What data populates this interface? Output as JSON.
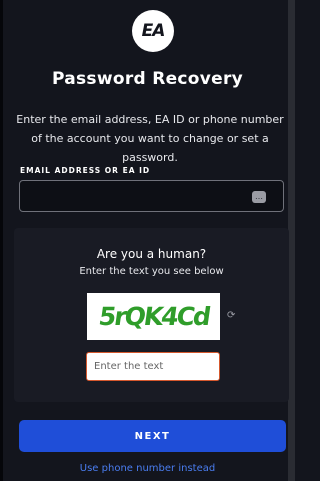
{
  "logo": {
    "text": "EA"
  },
  "title": "Password Recovery",
  "description": "Enter the email address, EA ID or phone number of the account you want to change or set a password.",
  "email_field": {
    "label": "EMAIL ADDRESS OR EA ID",
    "value": "",
    "autofill_icon": "…"
  },
  "captcha": {
    "question": "Are you a human?",
    "instruction": "Enter the text you see below",
    "image_text": "5rQK4Cd",
    "refresh_icon": "refresh-icon",
    "input_placeholder": "Enter the text"
  },
  "next_label": "NEXT",
  "alt_link": "Use phone number instead",
  "colors": {
    "accent": "#1f4ed8",
    "link": "#4a7df0",
    "captcha_border": "#d5582d",
    "background": "#13151d"
  }
}
